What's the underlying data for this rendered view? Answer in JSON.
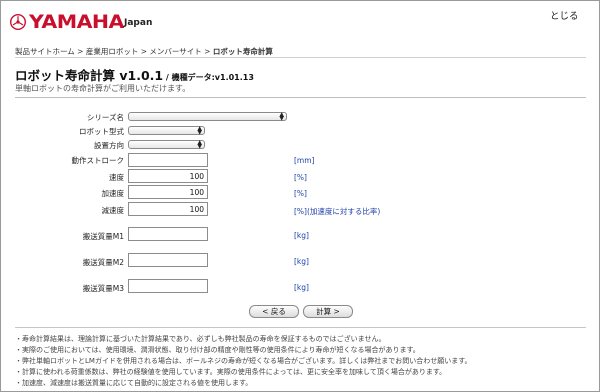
{
  "header": {
    "brand": "YAMAHA",
    "region": "Japan",
    "close_label": "とじる"
  },
  "breadcrumb": {
    "items": [
      "製品サイトホーム",
      "産業用ロボット",
      "メンバーサイト"
    ],
    "separator": " > ",
    "current": "ロボット寿命計算"
  },
  "page": {
    "title": "ロボット寿命計算 v1.0.1",
    "data_version": " / 機種データ:v1.01.13",
    "subtitle": "単軸ロボットの寿命計算がご利用いただけます。"
  },
  "form": {
    "series": {
      "label": "シリーズ名",
      "value": ""
    },
    "model": {
      "label": "ロボット型式",
      "value": ""
    },
    "orientation": {
      "label": "設置方向",
      "value": ""
    },
    "stroke": {
      "label": "動作ストローク",
      "value": "",
      "unit": "[mm]"
    },
    "speed": {
      "label": "速度",
      "value": "100",
      "unit": "[%]"
    },
    "accel": {
      "label": "加速度",
      "value": "100",
      "unit": "[%]"
    },
    "decel": {
      "label": "減速度",
      "value": "100",
      "unit": "[%](加速度に対する比率)"
    },
    "m1": {
      "label": "搬送質量M1",
      "value": "",
      "unit": "[kg]"
    },
    "m2": {
      "label": "搬送質量M2",
      "value": "",
      "unit": "[kg]"
    },
    "m3": {
      "label": "搬送質量M3",
      "value": "",
      "unit": "[kg]"
    }
  },
  "buttons": {
    "back": "< 戻る",
    "calc": "計算 >"
  },
  "notes": [
    "・寿命計算結果は、理論計算に基づいた計算結果であり、必ずしも弊社製品の寿命を保証するものではございません。",
    "・実際のご使用においては、使用環境、潤滑状態、取り付け部の精度や剛性等の使用条件により寿命が短くなる場合があります。",
    "・弊社単軸ロボットとLMガイドを併用される場合は、ボールネジの寿命が短くなる場合がございます。詳しくは弊社までお問い合わせ願います。",
    "・計算に使われる荷重係数は、弊社の経験値を使用しています。実際の使用条件によっては、更に安全率を加味して頂く場合があります。",
    "・加速度、減速度は搬送質量に応じて自動的に設定される値を使用します。"
  ],
  "colors": {
    "brand_red": "#c8102e",
    "unit_blue": "#1c3fa8"
  },
  "icons": {
    "logo": "tuning-fork-emblem",
    "select_arrow": "updown-arrows-icon"
  }
}
